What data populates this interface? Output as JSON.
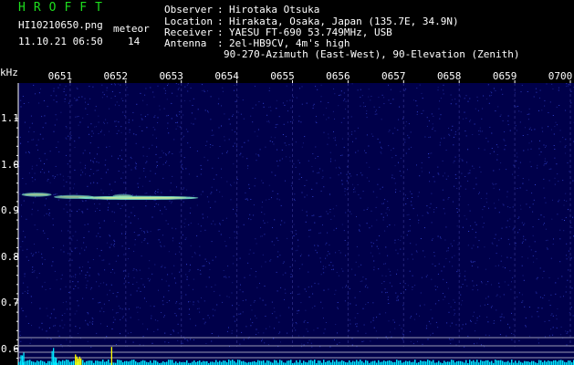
{
  "logo_text": "HROFFT",
  "file_name": "HI10210650.png",
  "datetime": "11.10.21 06:50",
  "counter_label": "meteor",
  "counter_value": "14",
  "station": {
    "observer_label": "Observer",
    "observer": "Hirotaka Otsuka",
    "location_label": "Location",
    "location": "Hirakata, Osaka, Japan (135.7E, 34.9N)",
    "receiver_label": "Receiver",
    "receiver": "YAESU FT-690 53.749MHz, USB",
    "antenna_label": "Antenna",
    "antenna_line1": "2el-HB9CV, 4m's high",
    "antenna_line2": "90-270-Azimuth (East-West), 90-Elevation (Zenith)"
  },
  "colors": {
    "background": "#000000",
    "plot_background": "#00004a",
    "logo": "#1ede1e",
    "echo": "#7fe8c8",
    "power_cyan": "#00e8ff",
    "power_yellow": "#ffff00"
  },
  "chart_data": {
    "type": "heatmap",
    "title": "",
    "y_unit_label": "kHz",
    "x_ticks": [
      "0651",
      "0652",
      "0653",
      "0654",
      "0655",
      "0656",
      "0657",
      "0658",
      "0659",
      "0700"
    ],
    "y_ticks": [
      "1.1",
      "1.0",
      "0.9",
      "0.8",
      "0.7",
      "0.6"
    ],
    "ylim": [
      0.6,
      1.1
    ],
    "xlim_minutes": [
      6.5,
      7.0
    ],
    "echoes": [
      {
        "t": 6.503,
        "f": 0.935,
        "duration_min": 0.003,
        "strength": 0.7
      },
      {
        "t": 6.532,
        "f": 0.93,
        "duration_min": 0.004,
        "strength": 0.6
      },
      {
        "t": 6.554,
        "f": 0.928,
        "duration_min": 0.012,
        "strength": 1.0
      },
      {
        "t": 6.585,
        "f": 0.932,
        "duration_min": 0.002,
        "strength": 0.4
      }
    ],
    "power_bursts": [
      {
        "t_start": 6.502,
        "t_end": 6.505,
        "color": "cyan"
      },
      {
        "t_start": 6.53,
        "t_end": 6.534,
        "color": "cyan"
      },
      {
        "t_start": 6.551,
        "t_end": 6.557,
        "color": "yellow"
      },
      {
        "t_start": 6.5835,
        "t_end": 6.5845,
        "color": "yellow"
      }
    ],
    "grid": true
  }
}
